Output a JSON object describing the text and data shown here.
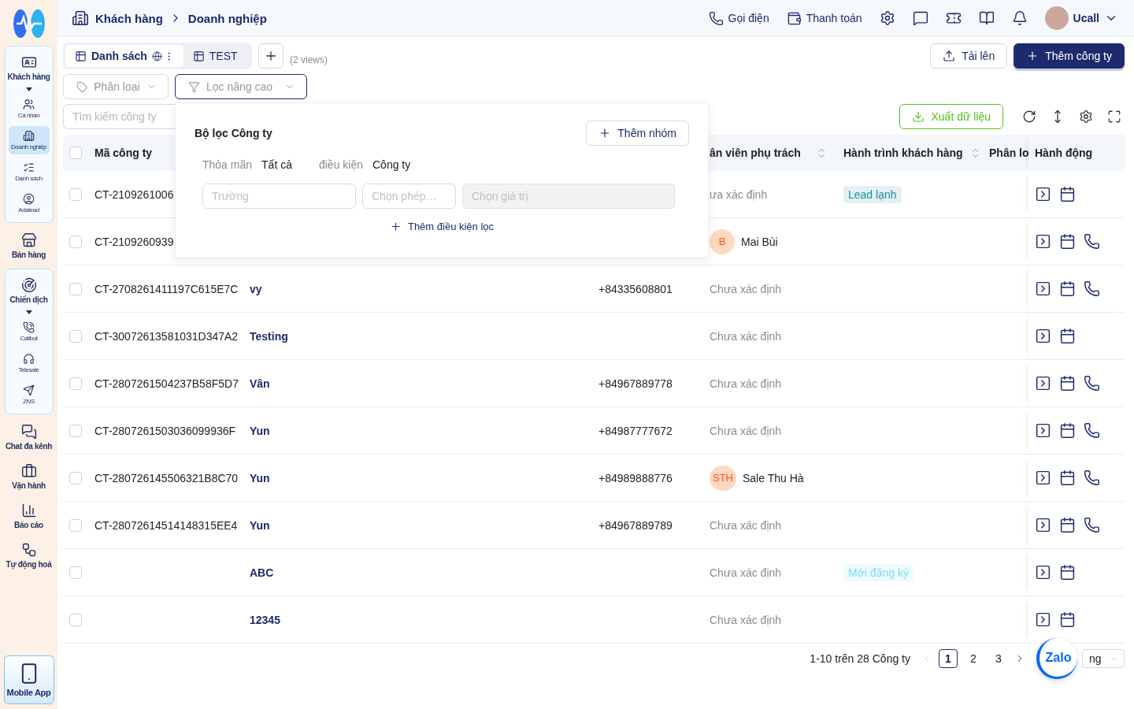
{
  "sidebar": {
    "nav": [
      {
        "label": "Khách hàng",
        "kind": "group",
        "expanded": true,
        "children": [
          {
            "label": "Cá nhân",
            "selected": false
          },
          {
            "label": "Doanh nghiệp",
            "selected": true
          },
          {
            "label": "Danh sách",
            "selected": false
          },
          {
            "label": "Adalead",
            "selected": false
          }
        ]
      },
      {
        "label": "Bán hàng",
        "kind": "item"
      },
      {
        "label": "Chiến dịch",
        "kind": "group",
        "expanded": true,
        "children": [
          {
            "label": "Callbot",
            "selected": false
          },
          {
            "label": "Telesale",
            "selected": false
          },
          {
            "label": "ZNS",
            "selected": false
          }
        ]
      },
      {
        "label": "Chat đa kênh",
        "kind": "item"
      },
      {
        "label": "Vận hành",
        "kind": "item"
      },
      {
        "label": "Báo cáo",
        "kind": "item"
      },
      {
        "label": "Tự động hoá",
        "kind": "item"
      }
    ],
    "mobile_app": {
      "label": "Mobile App"
    }
  },
  "topbar": {
    "breadcrumb": [
      "Khách hàng",
      "Doanh nghiệp"
    ],
    "actions": [
      "Gọi điện",
      "Thanh toán"
    ],
    "user": "Ucall"
  },
  "views": {
    "tabs": [
      {
        "label": "Danh sách",
        "selected": true,
        "shared": true
      },
      {
        "label": "TEST",
        "selected": false,
        "shared": false
      }
    ],
    "count": "(2 views)"
  },
  "page_actions": [
    "Tải lên",
    "Thêm công ty"
  ],
  "filters": [
    {
      "label": "Phân loại",
      "active": false
    },
    {
      "label": "Lọc nâng cao",
      "active": true
    }
  ],
  "search": {
    "placeholder": "Tìm kiếm công ty"
  },
  "export": "Xuất dữ liệu",
  "filter_panel": {
    "title": "Bộ lọc Công ty",
    "add_group": "Thêm nhóm",
    "match_label": "Thỏa mãn",
    "match_value": "Tất cả",
    "condition_label": "điều kiện",
    "condition_value": "Công ty",
    "fields": [
      {
        "placeholder": "Trường",
        "disabled": false
      },
      {
        "placeholder": "Chọn phép…",
        "disabled": false
      },
      {
        "placeholder": "Chọn giá trị",
        "disabled": true
      }
    ],
    "add_condition": "Thêm điều kiện lọc"
  },
  "table": {
    "all_checked": false,
    "columns": [
      {
        "label": "Mã công ty"
      },
      {},
      {},
      {
        "label": "ân viên phụ trách",
        "sortable": true
      },
      {
        "label": "Hành trình khách hàng",
        "sortable": true
      },
      {
        "label": "Phân lo"
      },
      {
        "label": "Hành động",
        "sortable": false
      }
    ],
    "rows": [
      {
        "checked": false,
        "code": "CT-2109261006",
        "staff": {
          "kind": "text",
          "text": "ưa xác định"
        },
        "journey": {
          "label": "Lead lạnh",
          "color": "#1b8fa0"
        },
        "actions": [
          {
            "kind": "open"
          },
          {
            "kind": "note"
          }
        ]
      },
      {
        "checked": false,
        "code": "CT-2109260939",
        "staff": {
          "kind": "person",
          "initials": "B",
          "name": "Mai Bùi"
        },
        "actions": [
          {
            "kind": "open"
          },
          {
            "kind": "note"
          },
          {
            "kind": "call"
          }
        ]
      },
      {
        "checked": false,
        "code": "CT-2708261411197C615E7C",
        "name": "vy",
        "phone": "+84335608801",
        "staff": {
          "kind": "text",
          "text": "Chưa xác định"
        },
        "actions": [
          {
            "kind": "open"
          },
          {
            "kind": "note"
          },
          {
            "kind": "call"
          }
        ]
      },
      {
        "checked": false,
        "code": "CT-30072613581031D347A2",
        "name": "Testing",
        "staff": {
          "kind": "text",
          "text": "Chưa xác định"
        },
        "actions": [
          {
            "kind": "open"
          },
          {
            "kind": "note"
          }
        ]
      },
      {
        "checked": false,
        "code": "CT-2807261504237B58F5D7",
        "name": "Vân",
        "phone": "+84967889778",
        "staff": {
          "kind": "text",
          "text": "Chưa xác định"
        },
        "actions": [
          {
            "kind": "open"
          },
          {
            "kind": "note"
          },
          {
            "kind": "call"
          }
        ]
      },
      {
        "checked": false,
        "code": "CT-2807261503036099936F",
        "name": "Yun",
        "phone": "+84987777672",
        "staff": {
          "kind": "text",
          "text": "Chưa xác định"
        },
        "actions": [
          {
            "kind": "open"
          },
          {
            "kind": "note"
          },
          {
            "kind": "call"
          }
        ]
      },
      {
        "checked": false,
        "code": "CT-280726145506321B8C70",
        "name": "Yun",
        "phone": "+84989888776",
        "staff": {
          "kind": "person",
          "initials": "STH",
          "name": "Sale Thu Hà"
        },
        "actions": [
          {
            "kind": "open"
          },
          {
            "kind": "note"
          },
          {
            "kind": "call"
          }
        ]
      },
      {
        "checked": false,
        "code": "CT-28072614514148315EE4",
        "name": "Yun",
        "phone": "+84967889789",
        "staff": {
          "kind": "text",
          "text": "Chưa xác định"
        },
        "actions": [
          {
            "kind": "open"
          },
          {
            "kind": "note"
          },
          {
            "kind": "call"
          }
        ]
      },
      {
        "checked": false,
        "name": "ABC",
        "staff": {
          "kind": "text",
          "text": "Chưa xác định"
        },
        "journey": {
          "label": "Mới đăng ký",
          "color": "#7fdcf5"
        },
        "actions": [
          {
            "kind": "open"
          },
          {
            "kind": "note"
          }
        ]
      },
      {
        "checked": false,
        "name": "12345",
        "staff": {
          "kind": "text",
          "text": "Chưa xác định"
        },
        "actions": [
          {
            "kind": "open"
          },
          {
            "kind": "note"
          }
        ]
      }
    ]
  },
  "pagination": {
    "summary": "1-10 trên 28 Công ty",
    "prev_disabled": true,
    "next_disabled": false,
    "pages": [
      {
        "label": "1",
        "selected": true
      },
      {
        "label": "2",
        "selected": false
      },
      {
        "label": "3",
        "selected": false
      }
    ],
    "page_size": "ng"
  },
  "chat_widget": {
    "label": "Zalo"
  }
}
